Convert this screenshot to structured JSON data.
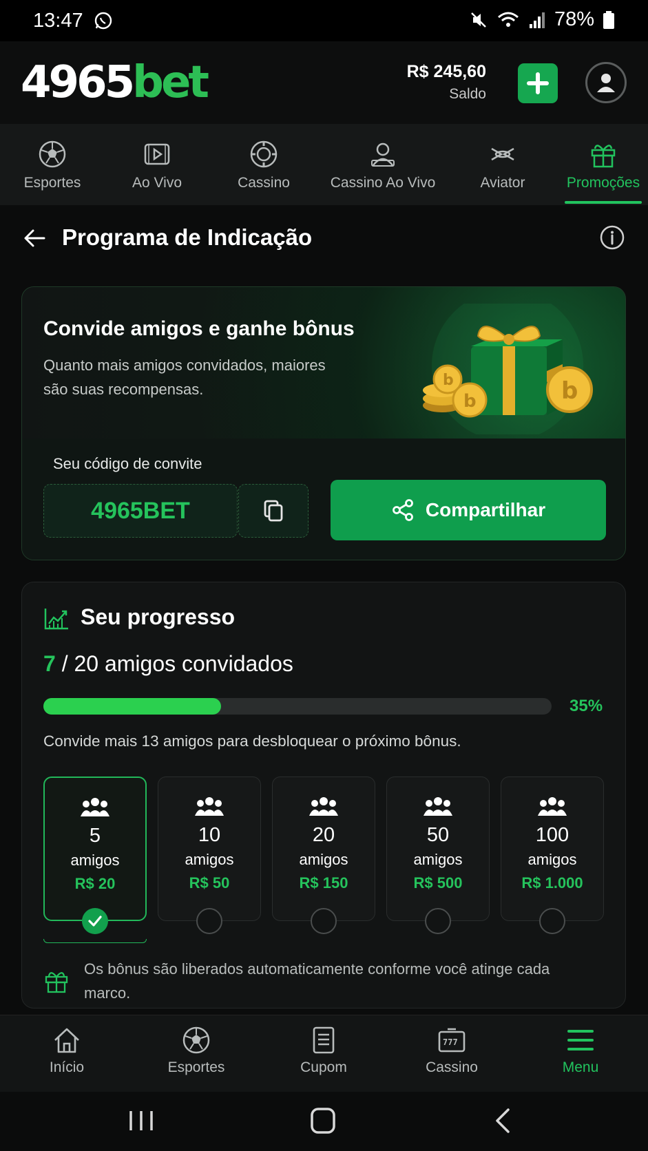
{
  "status_bar": {
    "time": "13:47",
    "battery": "78%"
  },
  "header": {
    "logo_part1": "4965",
    "logo_part2": "bet",
    "balance_value": "R$ 245,60",
    "balance_label": "Saldo"
  },
  "nav": {
    "items": [
      {
        "label": "Esportes",
        "icon": "soccer-ball-icon"
      },
      {
        "label": "Ao Vivo",
        "icon": "live-video-icon"
      },
      {
        "label": "Cassino",
        "icon": "casino-chip-icon"
      },
      {
        "label": "Cassino Ao Vivo",
        "icon": "live-dealer-icon"
      },
      {
        "label": "Aviator",
        "icon": "plane-icon"
      },
      {
        "label": "Promoções",
        "icon": "gift-icon",
        "active": true
      }
    ]
  },
  "page": {
    "title": "Programa de Indicação"
  },
  "invite": {
    "title": "Convide amigos e ganhe bônus",
    "subtitle": "Quanto mais amigos convidados, maiores são suas recompensas.",
    "code_label": "Seu código de convite",
    "code": "4965BET",
    "share_label": "Compartilhar"
  },
  "progress": {
    "title": "Seu progresso",
    "current": "7",
    "separator": " / ",
    "total_text": "20 amigos convidados",
    "percent_label": "35%",
    "percent_value": 35,
    "hint": "Convide mais 13 amigos para desbloquear o próximo bônus.",
    "milestones": [
      {
        "count": "5",
        "unit": "amigos",
        "reward": "R$ 20",
        "done": true
      },
      {
        "count": "10",
        "unit": "amigos",
        "reward": "R$ 50",
        "done": false
      },
      {
        "count": "20",
        "unit": "amigos",
        "reward": "R$ 150",
        "done": false
      },
      {
        "count": "50",
        "unit": "amigos",
        "reward": "R$ 500",
        "done": false
      },
      {
        "count": "100",
        "unit": "amigos",
        "reward": "R$ 1.000",
        "done": false
      }
    ],
    "note": "Os bônus são liberados automaticamente conforme você atinge cada marco."
  },
  "tabbar": {
    "items": [
      {
        "label": "Início",
        "icon": "home-icon"
      },
      {
        "label": "Esportes",
        "icon": "soccer-ball-icon"
      },
      {
        "label": "Cupom",
        "icon": "coupon-icon"
      },
      {
        "label": "Cassino",
        "icon": "slot-machine-icon"
      },
      {
        "label": "Menu",
        "icon": "menu-icon",
        "active": true
      }
    ]
  },
  "colors": {
    "accent": "#22c35e",
    "button": "#0f9e4d",
    "background": "#0b0c0c"
  }
}
